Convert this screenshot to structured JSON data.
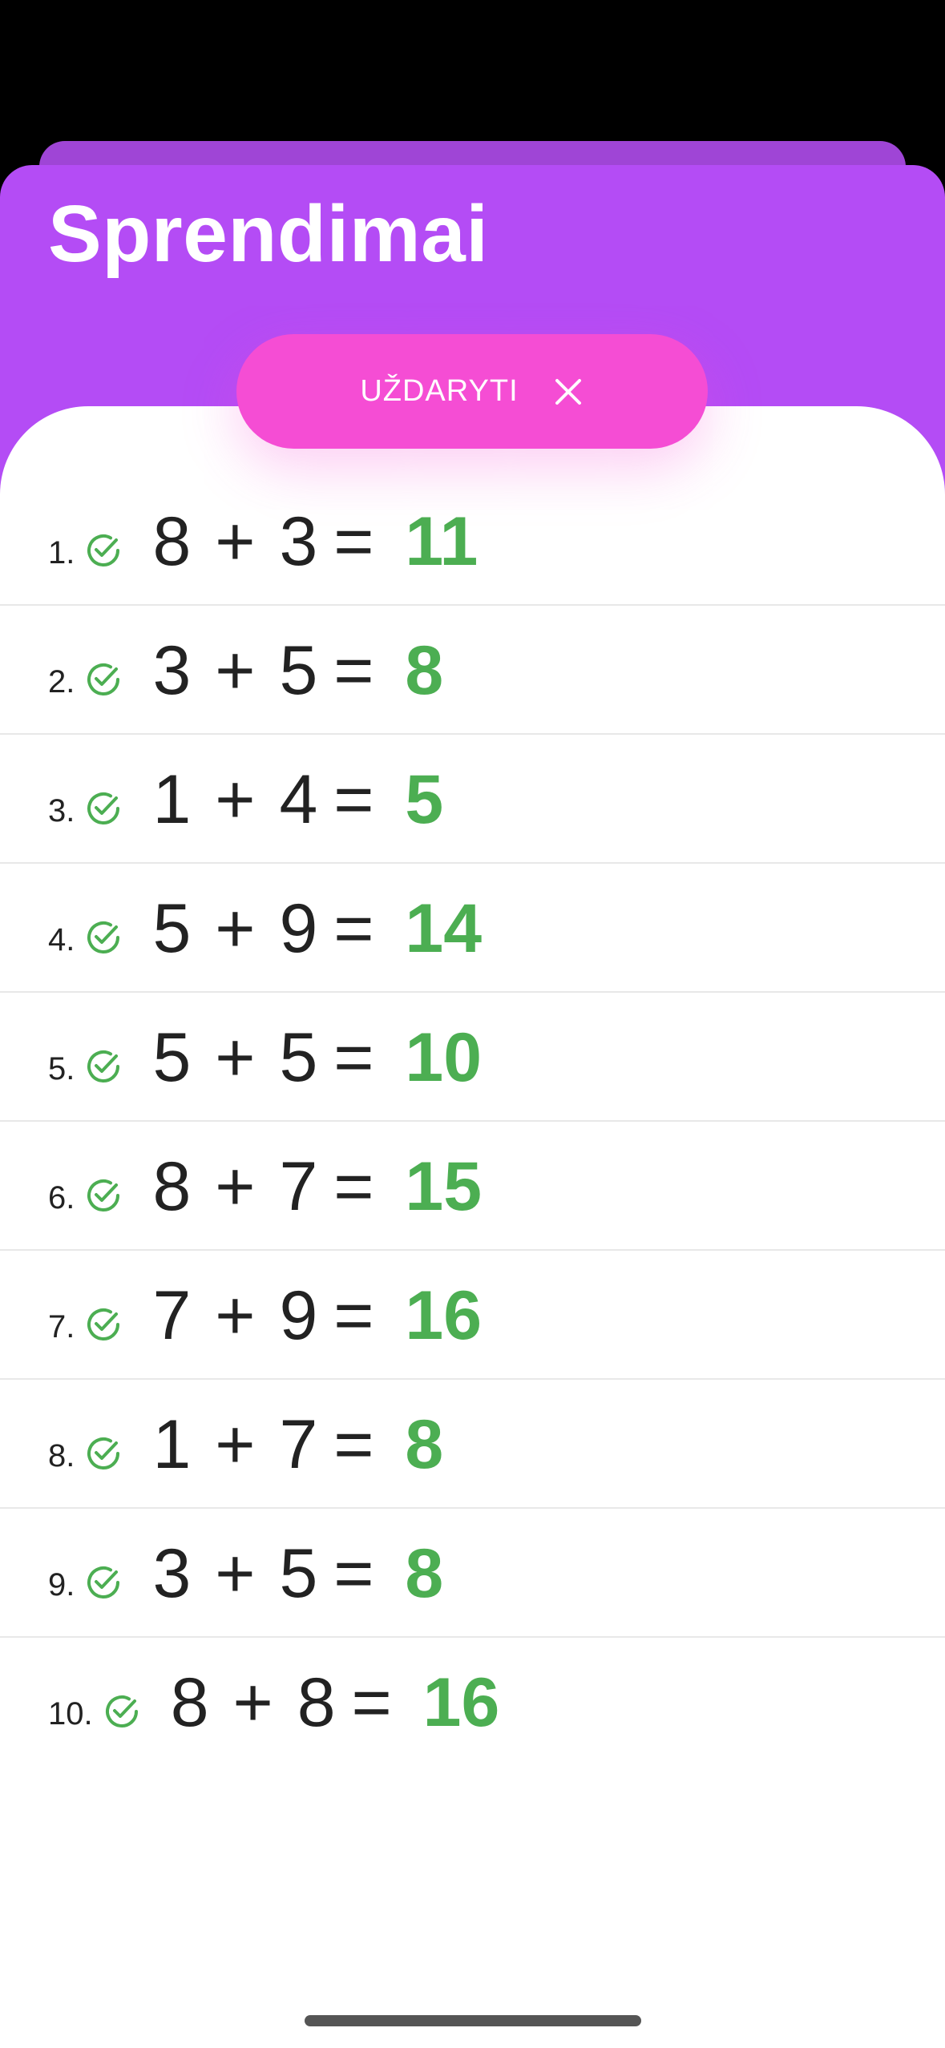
{
  "header": {
    "title": "Sprendimai"
  },
  "close_button": {
    "label": "UŽDARYTI",
    "icon": "close-icon"
  },
  "colors": {
    "header_bg": "#b44cf5",
    "back_sheet": "#9f45d6",
    "button_bg": "#f54dd4",
    "correct": "#4cae52"
  },
  "solutions": [
    {
      "index": "1.",
      "a": "8",
      "op": "+",
      "b": "3",
      "eq": "=",
      "answer": "11",
      "status": "check-circle-icon"
    },
    {
      "index": "2.",
      "a": "3",
      "op": "+",
      "b": "5",
      "eq": "=",
      "answer": "8",
      "status": "check-circle-icon"
    },
    {
      "index": "3.",
      "a": "1",
      "op": "+",
      "b": "4",
      "eq": "=",
      "answer": "5",
      "status": "check-circle-icon"
    },
    {
      "index": "4.",
      "a": "5",
      "op": "+",
      "b": "9",
      "eq": "=",
      "answer": "14",
      "status": "check-circle-icon"
    },
    {
      "index": "5.",
      "a": "5",
      "op": "+",
      "b": "5",
      "eq": "=",
      "answer": "10",
      "status": "check-circle-icon"
    },
    {
      "index": "6.",
      "a": "8",
      "op": "+",
      "b": "7",
      "eq": "=",
      "answer": "15",
      "status": "check-circle-icon"
    },
    {
      "index": "7.",
      "a": "7",
      "op": "+",
      "b": "9",
      "eq": "=",
      "answer": "16",
      "status": "check-circle-icon"
    },
    {
      "index": "8.",
      "a": "1",
      "op": "+",
      "b": "7",
      "eq": "=",
      "answer": "8",
      "status": "check-circle-icon"
    },
    {
      "index": "9.",
      "a": "3",
      "op": "+",
      "b": "5",
      "eq": "=",
      "answer": "8",
      "status": "check-circle-icon"
    },
    {
      "index": "10.",
      "a": "8",
      "op": "+",
      "b": "8",
      "eq": "=",
      "answer": "16",
      "status": "check-circle-icon"
    }
  ]
}
